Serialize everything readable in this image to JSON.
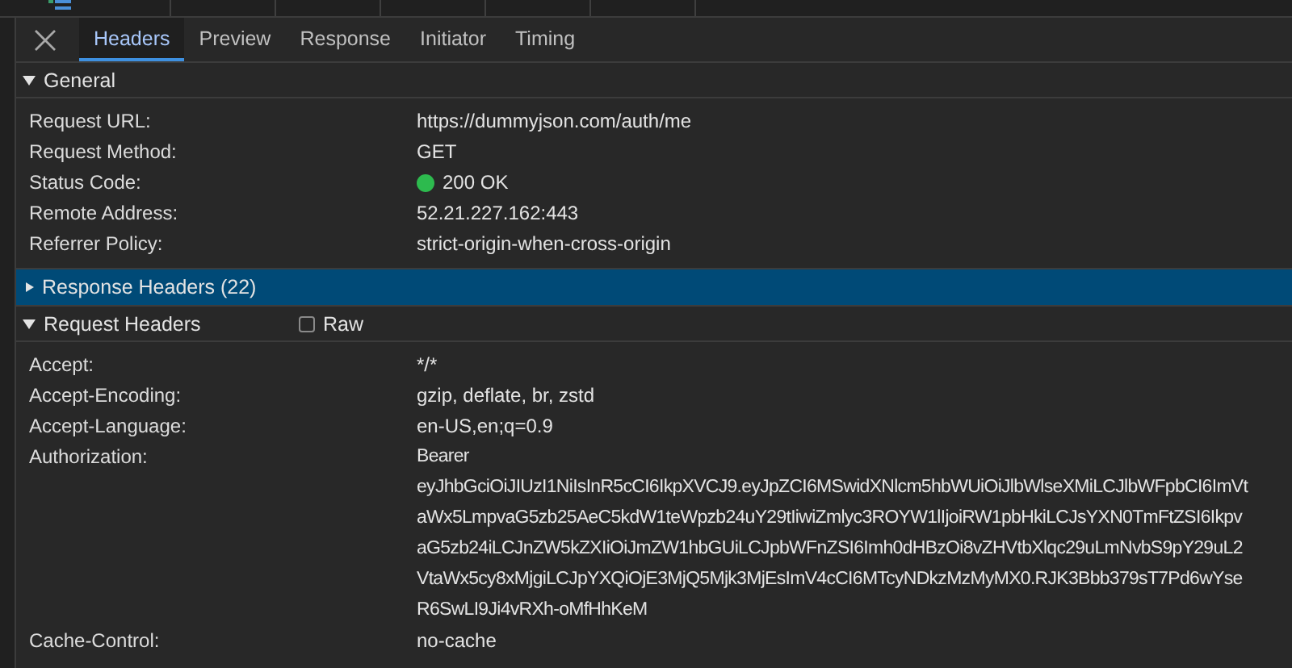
{
  "tabs": [
    {
      "label": "Headers",
      "selected": true
    },
    {
      "label": "Preview",
      "selected": false
    },
    {
      "label": "Response",
      "selected": false
    },
    {
      "label": "Initiator",
      "selected": false
    },
    {
      "label": "Timing",
      "selected": false
    }
  ],
  "sections": [
    {
      "title": "General",
      "expanded": true,
      "selected": false,
      "rows": [
        {
          "name": "Request URL:",
          "value": [
            "https://dummyjson.com/auth/me"
          ]
        },
        {
          "name": "Request Method:",
          "value": [
            "GET"
          ]
        },
        {
          "name": "Status Code:",
          "value": [
            "200 OK"
          ],
          "color": "#2dba4e"
        },
        {
          "name": "Remote Address:",
          "value": [
            "52.21.227.162:443"
          ]
        },
        {
          "name": "Referrer Policy:",
          "value": [
            "strict-origin-when-cross-origin"
          ]
        }
      ]
    },
    {
      "title": "Response Headers (22)",
      "expanded": false,
      "selected": true
    },
    {
      "title": "Request Headers",
      "expanded": true,
      "selected": false,
      "raw": {
        "label": "Raw",
        "checked": false
      },
      "rows": [
        {
          "name": "Accept:",
          "value": [
            "*/*"
          ]
        },
        {
          "name": "Accept-Encoding:",
          "value": [
            "gzip, deflate, br, zstd"
          ]
        },
        {
          "name": "Accept-Language:",
          "value": [
            "en-US,en;q=0.9"
          ]
        },
        {
          "name": "Authorization:",
          "value": [
            "Bearer",
            "eyJhbGciOiJIUzI1NiIsInR5cCI6IkpXVCJ9.eyJpZCI6MSwidXNlcm5hbWUiOiJlbWlseXMiLCJlbWFpbCI6ImVt",
            "aWx5LmpvaG5zb25AeC5kdW1teWpzb24uY29tIiwiZmlyc3ROYW1lIjoiRW1pbHkiLCJsYXN0TmFtZSI6Ikpv",
            "aG5zb24iLCJnZW5kZXIiOiJmZW1hbGUiLCJpbWFnZSI6Imh0dHBzOi8vZHVtbXlqc29uLmNvbS9pY29uL2",
            "VtaWx5cy8xMjgiLCJpYXQiOjE3MjQ5Mjk3MjEsImV4cCI6MTcyNDkzMzMyMX0.RJK3Bbb379sT7Pd6wYse",
            "R6SwLI9Ji4vRXh-oMfHhKeM"
          ]
        },
        {
          "name": "Cache-Control:",
          "value": [
            "no-cache"
          ]
        }
      ]
    }
  ]
}
